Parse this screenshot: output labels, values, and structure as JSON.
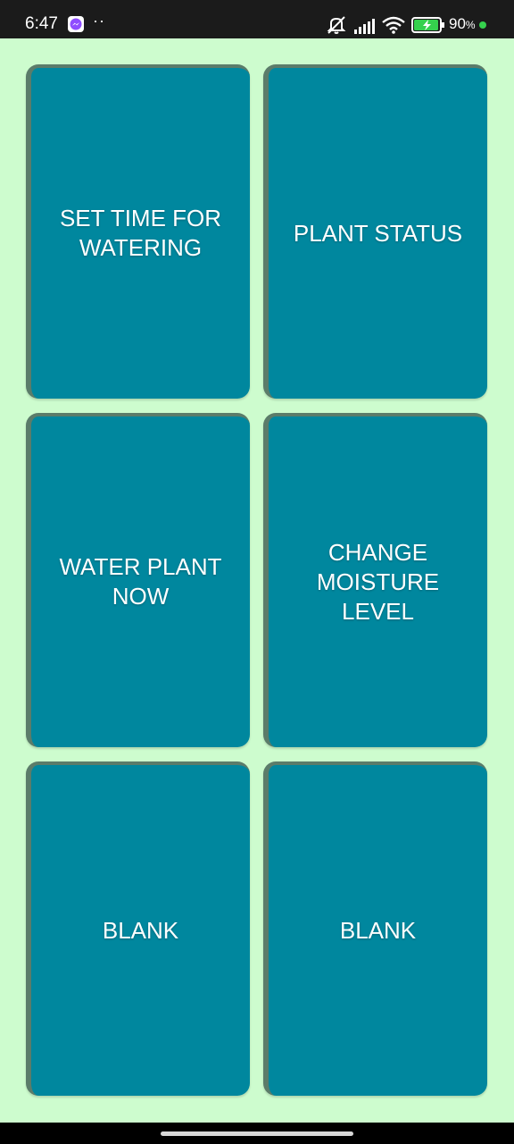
{
  "status_bar": {
    "time": "6:47",
    "dots": "··",
    "battery_percent": "90",
    "battery_suffix": "%",
    "icons": [
      "messenger-icon",
      "mute-icon",
      "signal-icon",
      "wifi-icon",
      "battery-charging-icon"
    ],
    "colors": {
      "background": "#1b1b1b",
      "battery": "#35d04d"
    }
  },
  "tiles": [
    {
      "label": "SET TIME FOR WATERING"
    },
    {
      "label": "PLANT STATUS"
    },
    {
      "label": "WATER PLANT NOW"
    },
    {
      "label": "CHANGE MOISTURE LEVEL"
    },
    {
      "label": "BLANK"
    },
    {
      "label": "BLANK"
    }
  ],
  "colors": {
    "page_background": "#cdfcce",
    "tile_background": "#00879e",
    "tile_border": "#5b7c6a",
    "tile_text": "#ffffff"
  }
}
